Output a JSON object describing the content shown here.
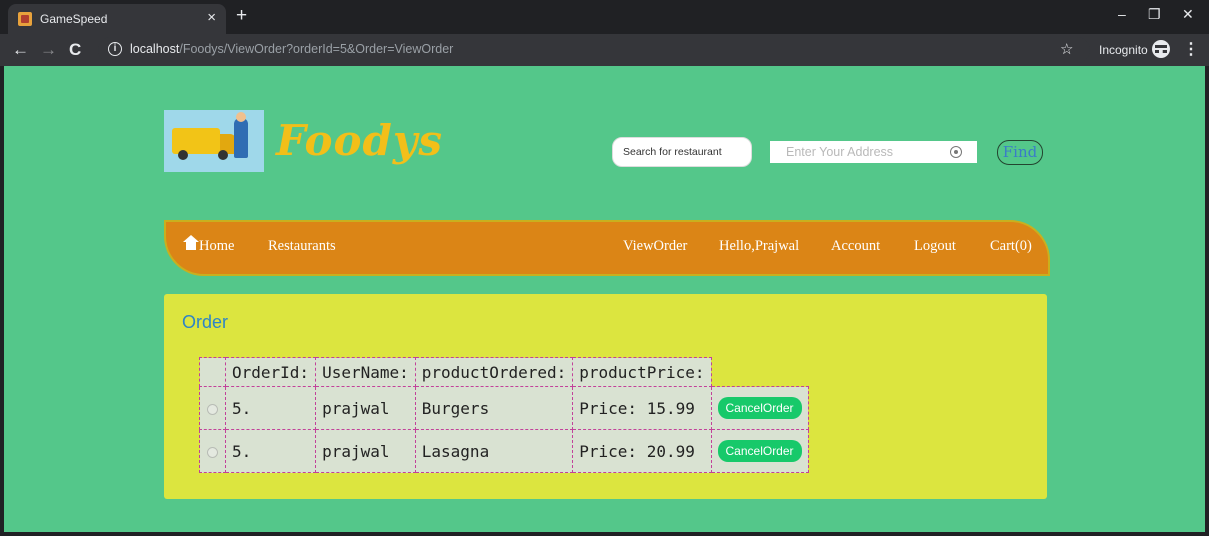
{
  "browser": {
    "tab_title": "GameSpeed",
    "tab_close": "×",
    "new_tab": "+",
    "url_host": "localhost",
    "url_path": "/Foodys/ViewOrder?orderId=5&Order=ViewOrder",
    "incognito_label": "Incognito",
    "controls": {
      "minimize": "–",
      "restore": "❐",
      "close": "✕"
    },
    "nav": {
      "back": "←",
      "forward": "→",
      "reload": "C"
    }
  },
  "site": {
    "logo_text": "Foodys",
    "brand_color": "#f2bf19",
    "page_bg": "#54c78a"
  },
  "search": {
    "restaurant_placeholder": "Search for restaurant",
    "address_placeholder": "Enter Your Address",
    "find_label": "Find"
  },
  "nav": {
    "home": "Home",
    "restaurants": "Restaurants",
    "view_order": "ViewOrder",
    "greeting": "Hello,Prajwal",
    "account": "Account",
    "logout": "Logout",
    "cart": "Cart(0)"
  },
  "order": {
    "title": "Order",
    "headers": [
      "OrderId:",
      "UserName:",
      "productOrdered:",
      "productPrice:"
    ],
    "rows": [
      {
        "order_id": "5.",
        "user": "prajwal",
        "product": "Burgers",
        "price": "Price: 15.99",
        "action": "CancelOrder"
      },
      {
        "order_id": "5.",
        "user": "prajwal",
        "product": "Lasagna",
        "price": "Price: 20.99",
        "action": "CancelOrder"
      }
    ]
  }
}
